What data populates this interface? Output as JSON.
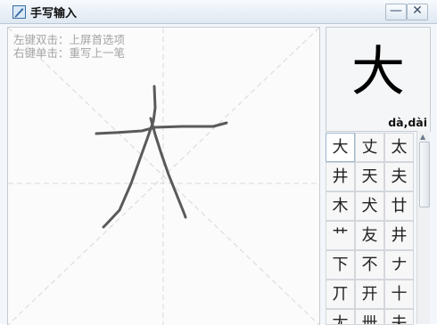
{
  "window": {
    "title": "手写输入",
    "minimize_glyph": "—",
    "close_glyph": "✕",
    "icon": "handwriting-pen-icon"
  },
  "canvas": {
    "hint_left_double_click": "左键双击：上屏首选项",
    "hint_right_click": "右键单击：重写上一笔"
  },
  "preview": {
    "character": "大",
    "pinyin": "dà,dài"
  },
  "candidates": {
    "rows": [
      [
        "大",
        "丈",
        "太"
      ],
      [
        "井",
        "天",
        "夫"
      ],
      [
        "木",
        "犬",
        "廿"
      ],
      [
        "艹",
        "友",
        "井"
      ],
      [
        "下",
        "不",
        "ナ"
      ],
      [
        "丌",
        "开",
        "十"
      ],
      [
        "尢",
        "卌",
        "夫"
      ]
    ],
    "selected_index": 0
  },
  "colors": {
    "stroke": "#555555",
    "guide": "#d6d6d6",
    "accent": "#3a6ea5"
  }
}
